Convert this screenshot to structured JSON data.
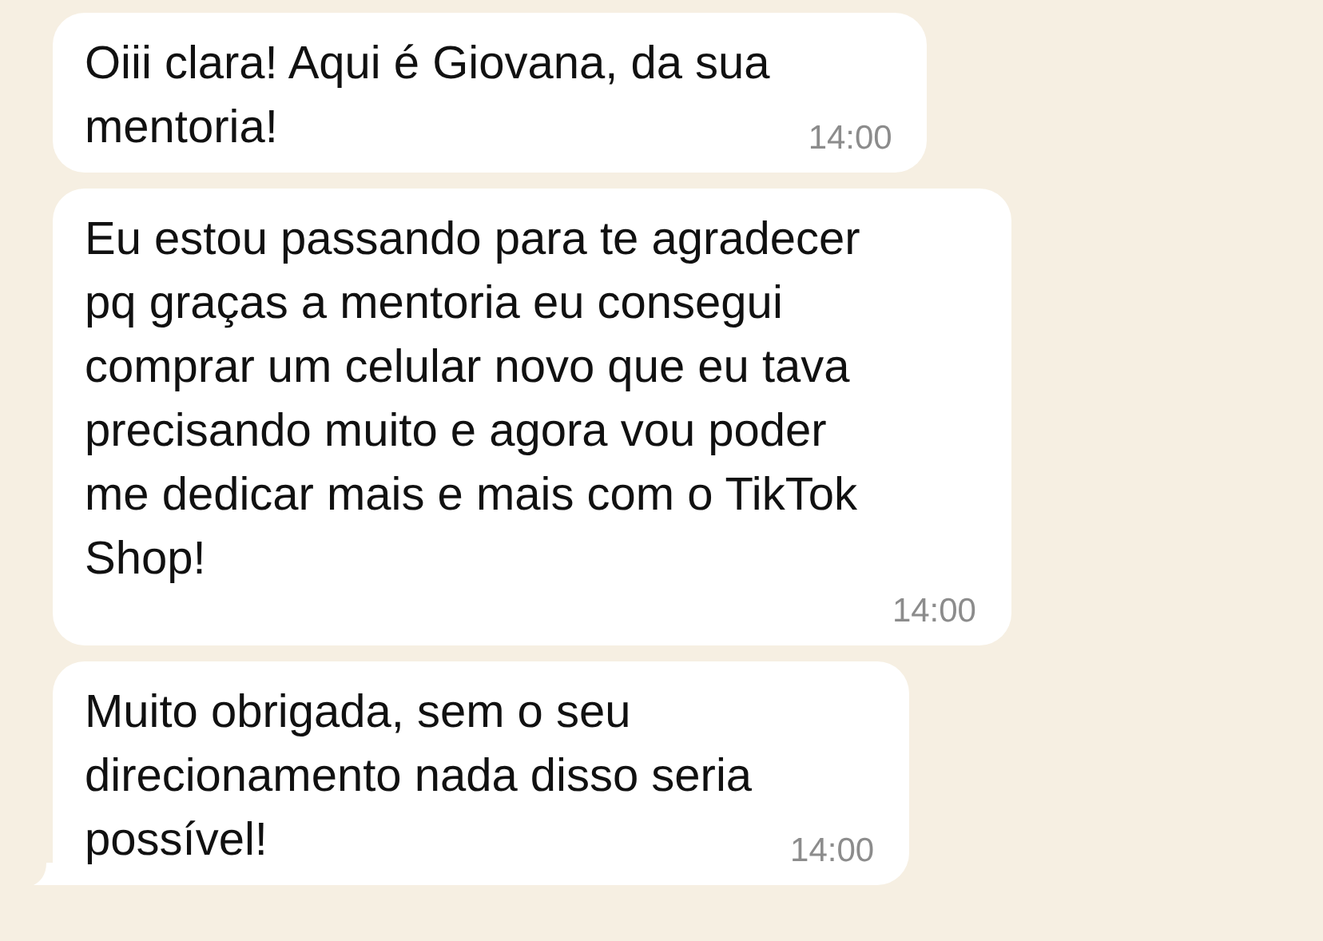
{
  "messages": [
    {
      "text": "Oiii clara! Aqui é Giovana, da sua\nmentoria!",
      "time": "14:00",
      "tail": false
    },
    {
      "text": "Eu estou passando para te agradecer\npq graças a mentoria eu consegui\ncomprar um celular novo que eu tava\nprecisando muito e agora vou poder\nme dedicar mais e mais com o TikTok\nShop!",
      "time": "14:00",
      "tail": false
    },
    {
      "text": "Muito obrigada, sem o seu\ndirecionamento nada disso seria\npossível!",
      "time": "14:00",
      "tail": true
    }
  ]
}
